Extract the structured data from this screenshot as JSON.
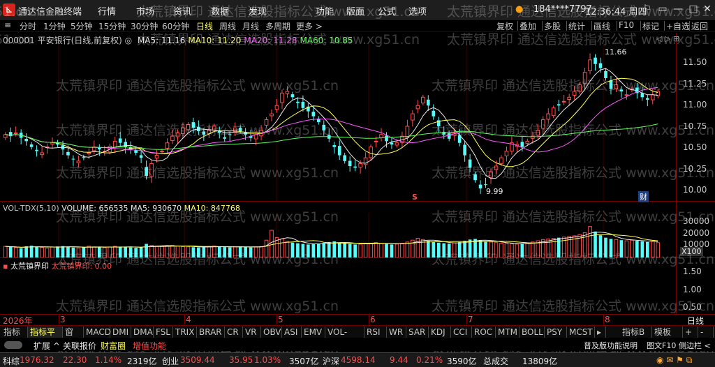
{
  "app": {
    "logo_glyph": "⊾",
    "title": "通达信金融终端",
    "menus": [
      "行情",
      "市场",
      "资讯",
      "数据",
      "发现",
      "功能",
      "版面",
      "公式",
      "选项"
    ],
    "user": "184****7797",
    "clock": "12:36:44 周四",
    "window_buttons": [
      "⚐",
      "▭",
      "—",
      "□",
      "✕"
    ]
  },
  "toolbar": {
    "left_icon": "≡",
    "periods": [
      "分时",
      "1分钟",
      "5分钟",
      "15分钟",
      "30分钟",
      "60分钟",
      "日线",
      "周线",
      "月线",
      "多周期",
      "更多 >"
    ],
    "active_period": "日线",
    "right_buttons": [
      "复权",
      "叠加",
      "多股",
      "统计",
      "画线",
      "F10",
      "标记",
      "+自选",
      "返回"
    ]
  },
  "main_chart": {
    "code_name": "000001 平安银行(日线,前复权)",
    "info_icon": "◎",
    "ma_labels": [
      {
        "text": "MA5: 11.16",
        "color": "#e8e8e8"
      },
      {
        "text": "MA10: 11.20",
        "color": "#ffff55"
      },
      {
        "text": "MA20: 11.28",
        "color": "#ff55ff"
      },
      {
        "text": "MA60: 10.85",
        "color": "#55ff55"
      }
    ],
    "corner_icons": "◁ ▷ ⊞",
    "high_label": "11.66",
    "low_label": "9.99",
    "marker_s": "S",
    "marker_cai": "财",
    "y_ticks": [
      "11.50",
      "11.25",
      "11.00",
      "10.75",
      "10.50",
      "10.25",
      "10.00"
    ]
  },
  "volume_panel": {
    "name": "VOL-TDX(5,10)",
    "volume": "VOLUME: 656535",
    "ma5": "MA5: 930670",
    "ma10": "MA10: 847768",
    "y_ticks": [
      "30000",
      "20000",
      "10000"
    ],
    "unit": "X100"
  },
  "indicator_panel": {
    "name": "太荒镇界印",
    "value_label": "太荒镇界印: 0.00",
    "y_ticks": [
      "1.50",
      "1.00",
      "0.50"
    ]
  },
  "time_axis": {
    "labels": [
      "2026年",
      "3",
      "4",
      "5",
      "6",
      "7",
      "8"
    ],
    "right_label": "日线"
  },
  "indicator_tabs": {
    "items": [
      "指标A",
      "指标平台",
      "窗口",
      "MACD",
      "DMI",
      "DMA",
      "FSL",
      "TRIX",
      "BRAR",
      "CR",
      "VR",
      "OBV",
      "ASI",
      "EMV",
      "VOL-TDX",
      "RSI",
      "WR",
      "SAR",
      "KDJ",
      "CCI",
      "ROC",
      "MTM",
      "BOLL",
      "PSY",
      "MCST"
    ],
    "active": "指标平台",
    "more": "▸",
    "right": [
      "指标B",
      "模板",
      "+",
      "-"
    ]
  },
  "func_bar": {
    "left": [
      "扩展 ^",
      "关联报价",
      "财富圈",
      "增值功能"
    ],
    "right": [
      "普及版功能说明",
      "图文F10",
      "侧边栏 <"
    ]
  },
  "status_bar": [
    {
      "name": "科综",
      "value": "1976.32",
      "change": "22.30",
      "pct": "1.14%",
      "amount": "2319亿"
    },
    {
      "name": "创业",
      "value": "3509.44",
      "change": "35.95",
      "pct": "1.03%",
      "amount": "3507亿"
    },
    {
      "name": "沪深",
      "value": "4598.14",
      "change": "9.44",
      "pct": "0.21%",
      "amount": "3590亿"
    },
    {
      "name": "总成交",
      "value": "13809亿"
    }
  ],
  "status_icons": "◉ ✉ ⚑ ⧉",
  "watermark": "太荒镇界印 通达信选股指标公式 www.xg51.cn",
  "colors": {
    "up": "#ff4d4d",
    "down": "#54fcfc",
    "ma5": "#e8e8e8",
    "ma10": "#ffff55",
    "ma20": "#ff55ff",
    "ma60": "#55ff55",
    "frame": "#7a0000"
  },
  "chart_data": {
    "type": "candlestick",
    "title": "000001 平安银行(日线,前复权)",
    "ylim": [
      9.95,
      11.75
    ],
    "volume_ylim": [
      0,
      35000
    ],
    "months": [
      "2026年",
      "3",
      "4",
      "5",
      "6",
      "7",
      "8"
    ],
    "high": 11.66,
    "low": 9.99,
    "closes": [
      10.7,
      10.68,
      10.72,
      10.66,
      10.62,
      10.55,
      10.5,
      10.48,
      10.55,
      10.6,
      10.58,
      10.52,
      10.45,
      10.4,
      10.38,
      10.42,
      10.48,
      10.55,
      10.52,
      10.5,
      10.56,
      10.62,
      10.6,
      10.55,
      10.52,
      10.48,
      10.42,
      10.2,
      10.35,
      10.45,
      10.5,
      10.6,
      10.68,
      10.72,
      10.78,
      10.82,
      10.78,
      10.74,
      10.7,
      10.75,
      10.8,
      10.72,
      10.65,
      10.7,
      10.78,
      10.74,
      10.7,
      10.66,
      10.7,
      10.75,
      10.88,
      10.95,
      11.05,
      11.2,
      11.22,
      11.15,
      11.08,
      11.02,
      10.98,
      10.92,
      10.85,
      10.75,
      10.65,
      10.55,
      10.45,
      10.38,
      10.32,
      10.3,
      10.35,
      10.42,
      10.55,
      10.62,
      10.7,
      10.62,
      10.58,
      10.6,
      10.68,
      10.8,
      10.95,
      11.05,
      11.15,
      11.05,
      10.92,
      10.8,
      10.7,
      10.65,
      10.72,
      10.6,
      10.45,
      10.3,
      10.15,
      10.05,
      10.1,
      10.25,
      10.32,
      10.42,
      10.5,
      10.6,
      10.58,
      10.55,
      10.62,
      10.68,
      10.75,
      10.88,
      10.95,
      11.02,
      11.05,
      11.1,
      11.15,
      11.22,
      11.3,
      11.45,
      11.6,
      11.55,
      11.5,
      11.38,
      11.25,
      11.3,
      11.22,
      11.18,
      11.25,
      11.2,
      11.15,
      11.12,
      11.18,
      11.22
    ],
    "volumes": [
      9000,
      8500,
      8000,
      7500,
      9000,
      9500,
      8800,
      8200,
      7600,
      8400,
      8900,
      9200,
      8700,
      8000,
      7700,
      8300,
      9100,
      8600,
      8200,
      7900,
      8500,
      9000,
      8800,
      8400,
      8100,
      7800,
      8300,
      11000,
      9800,
      9200,
      8900,
      9400,
      9800,
      9200,
      8800,
      8600,
      8300,
      8100,
      8500,
      8900,
      9200,
      8800,
      8400,
      8200,
      8600,
      8900,
      8500,
      8100,
      8400,
      8800,
      14000,
      22000,
      16000,
      15000,
      13000,
      12000,
      11500,
      11000,
      10500,
      10800,
      11200,
      11800,
      12500,
      13000,
      12000,
      11500,
      11000,
      10500,
      10800,
      11200,
      11600,
      12000,
      11400,
      10900,
      10500,
      10800,
      11500,
      12500,
      14000,
      15500,
      14500,
      13500,
      12500,
      12000,
      11500,
      11200,
      11800,
      12500,
      13500,
      14500,
      15000,
      14000,
      13000,
      12500,
      12000,
      11500,
      11200,
      11000,
      10800,
      11200,
      11800,
      12500,
      13500,
      14500,
      15000,
      15500,
      16000,
      16500,
      17000,
      17500,
      18500,
      20000,
      25000,
      21000,
      18000,
      16000,
      15000,
      14500,
      14000,
      13500,
      14000,
      13500,
      13000,
      12500,
      13000,
      12000
    ]
  }
}
